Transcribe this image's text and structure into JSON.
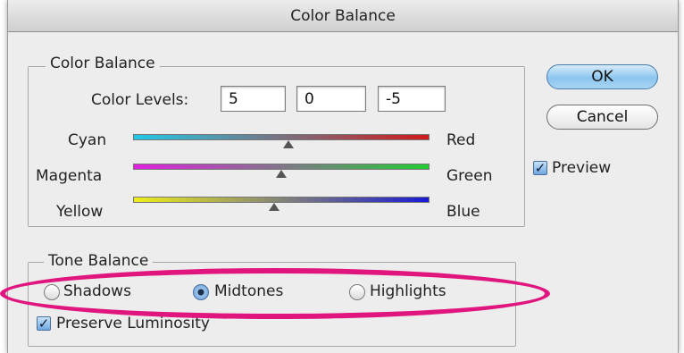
{
  "dialog": {
    "title": "Color Balance",
    "buttons": {
      "ok": "OK",
      "cancel": "Cancel"
    },
    "preview": {
      "label": "Preview",
      "checked": true
    }
  },
  "color_balance": {
    "legend": "Color Balance",
    "color_levels_label": "Color Levels:",
    "levels": [
      "5",
      "0",
      "-5"
    ],
    "sliders": [
      {
        "left": "Cyan",
        "right": "Red",
        "value": 5,
        "range": [
          -100,
          100
        ],
        "colors": [
          "#21c9e8",
          "#d11a1a"
        ]
      },
      {
        "left": "Magenta",
        "right": "Green",
        "value": 0,
        "range": [
          -100,
          100
        ],
        "colors": [
          "#e020e0",
          "#22cc33"
        ]
      },
      {
        "left": "Yellow",
        "right": "Blue",
        "value": -5,
        "range": [
          -100,
          100
        ],
        "colors": [
          "#eded1a",
          "#1a1ad6"
        ]
      }
    ]
  },
  "tone_balance": {
    "legend": "Tone Balance",
    "options": [
      {
        "label": "Shadows",
        "selected": false
      },
      {
        "label": "Midtones",
        "selected": true
      },
      {
        "label": "Highlights",
        "selected": false
      }
    ],
    "preserve_luminosity": {
      "label": "Preserve Luminosity",
      "checked": true
    }
  },
  "annotation": {
    "color": "#e0157e"
  }
}
